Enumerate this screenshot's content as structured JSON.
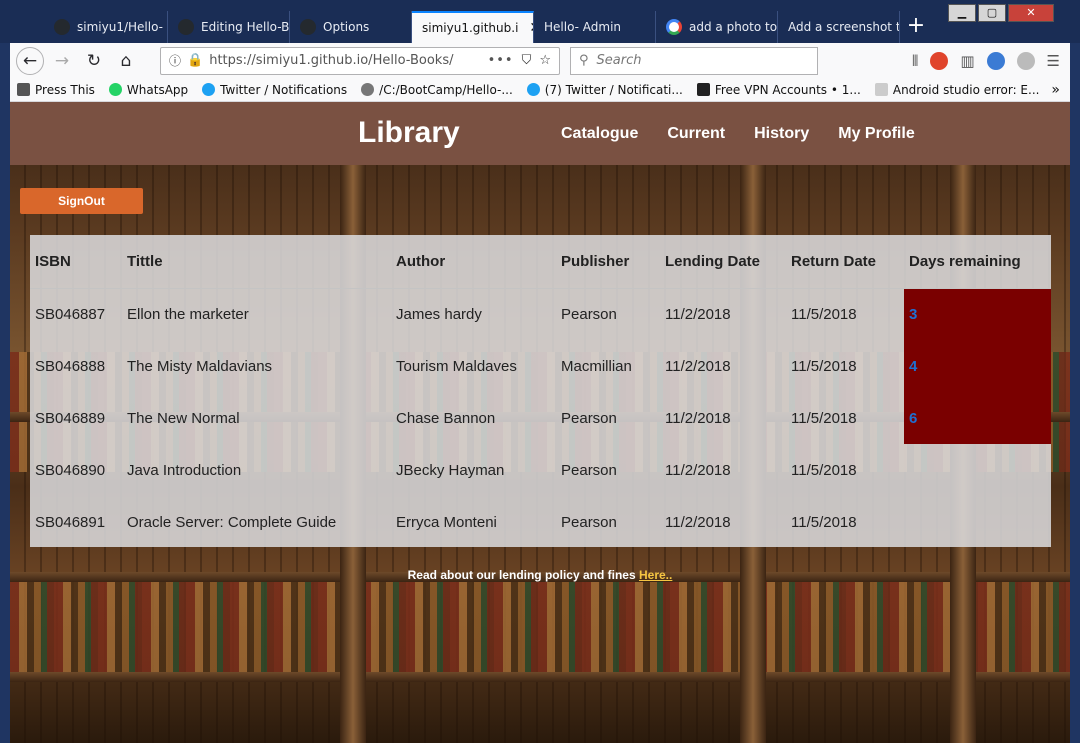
{
  "browser": {
    "tabs": [
      {
        "label": "simiyu1/Hello-",
        "icon": "github-icon",
        "active": false
      },
      {
        "label": "Editing Hello-B",
        "icon": "github-icon",
        "active": false
      },
      {
        "label": "Options",
        "icon": "github-icon",
        "active": false
      },
      {
        "label": "simiyu1.github.i",
        "icon": "none",
        "active": true
      },
      {
        "label": "Hello- Admin",
        "icon": "none",
        "active": false
      },
      {
        "label": "add a photo to",
        "icon": "google-icon",
        "active": false
      },
      {
        "label": "Add a screenshot to",
        "icon": "none",
        "active": false
      }
    ],
    "url": "https://simiyu1.github.io/Hello-Books/",
    "search_placeholder": "Search",
    "bookmarks": [
      {
        "label": "Press This"
      },
      {
        "label": "WhatsApp"
      },
      {
        "label": "Twitter / Notifications"
      },
      {
        "label": "/C:/BootCamp/Hello-..."
      },
      {
        "label": "(7) Twitter / Notificati..."
      },
      {
        "label": "Free VPN Accounts • 1..."
      },
      {
        "label": "Android studio error: E..."
      }
    ]
  },
  "site": {
    "brand": "Library",
    "nav": [
      "Catalogue",
      "Current",
      "History",
      "My Profile"
    ],
    "signout_label": "SignOut"
  },
  "table": {
    "headers": [
      "ISBN",
      "Tittle",
      "Author",
      "Publisher",
      "Lending Date",
      "Return Date",
      "Days remaining"
    ],
    "rows": [
      [
        "SB046887",
        "Ellon the marketer",
        "James hardy",
        "Pearson",
        "11/2/2018",
        "11/5/2018",
        "3"
      ],
      [
        "SB046888",
        "The Misty Maldavians",
        "Tourism Maldaves",
        "Macmillian",
        "11/2/2018",
        "11/5/2018",
        "4"
      ],
      [
        "SB046889",
        "The New Normal",
        "Chase Bannon",
        "Pearson",
        "11/2/2018",
        "11/5/2018",
        "6"
      ],
      [
        "SB046890",
        "Java Introduction",
        "JBecky Hayman",
        "Pearson",
        "11/2/2018",
        "11/5/2018",
        ""
      ],
      [
        "SB046891",
        "Oracle Server: Complete Guide",
        "Erryca Monteni",
        "Pearson",
        "11/2/2018",
        "11/5/2018",
        ""
      ]
    ]
  },
  "footer": {
    "text": "Read about our lending policy and fines ",
    "link": "Here.."
  },
  "colors": {
    "header_bg": "#7a5142",
    "signout_bg": "#d9672b",
    "days_highlight": "#7a0000",
    "days_text": "#1f6fd1",
    "link": "#f5c542"
  }
}
